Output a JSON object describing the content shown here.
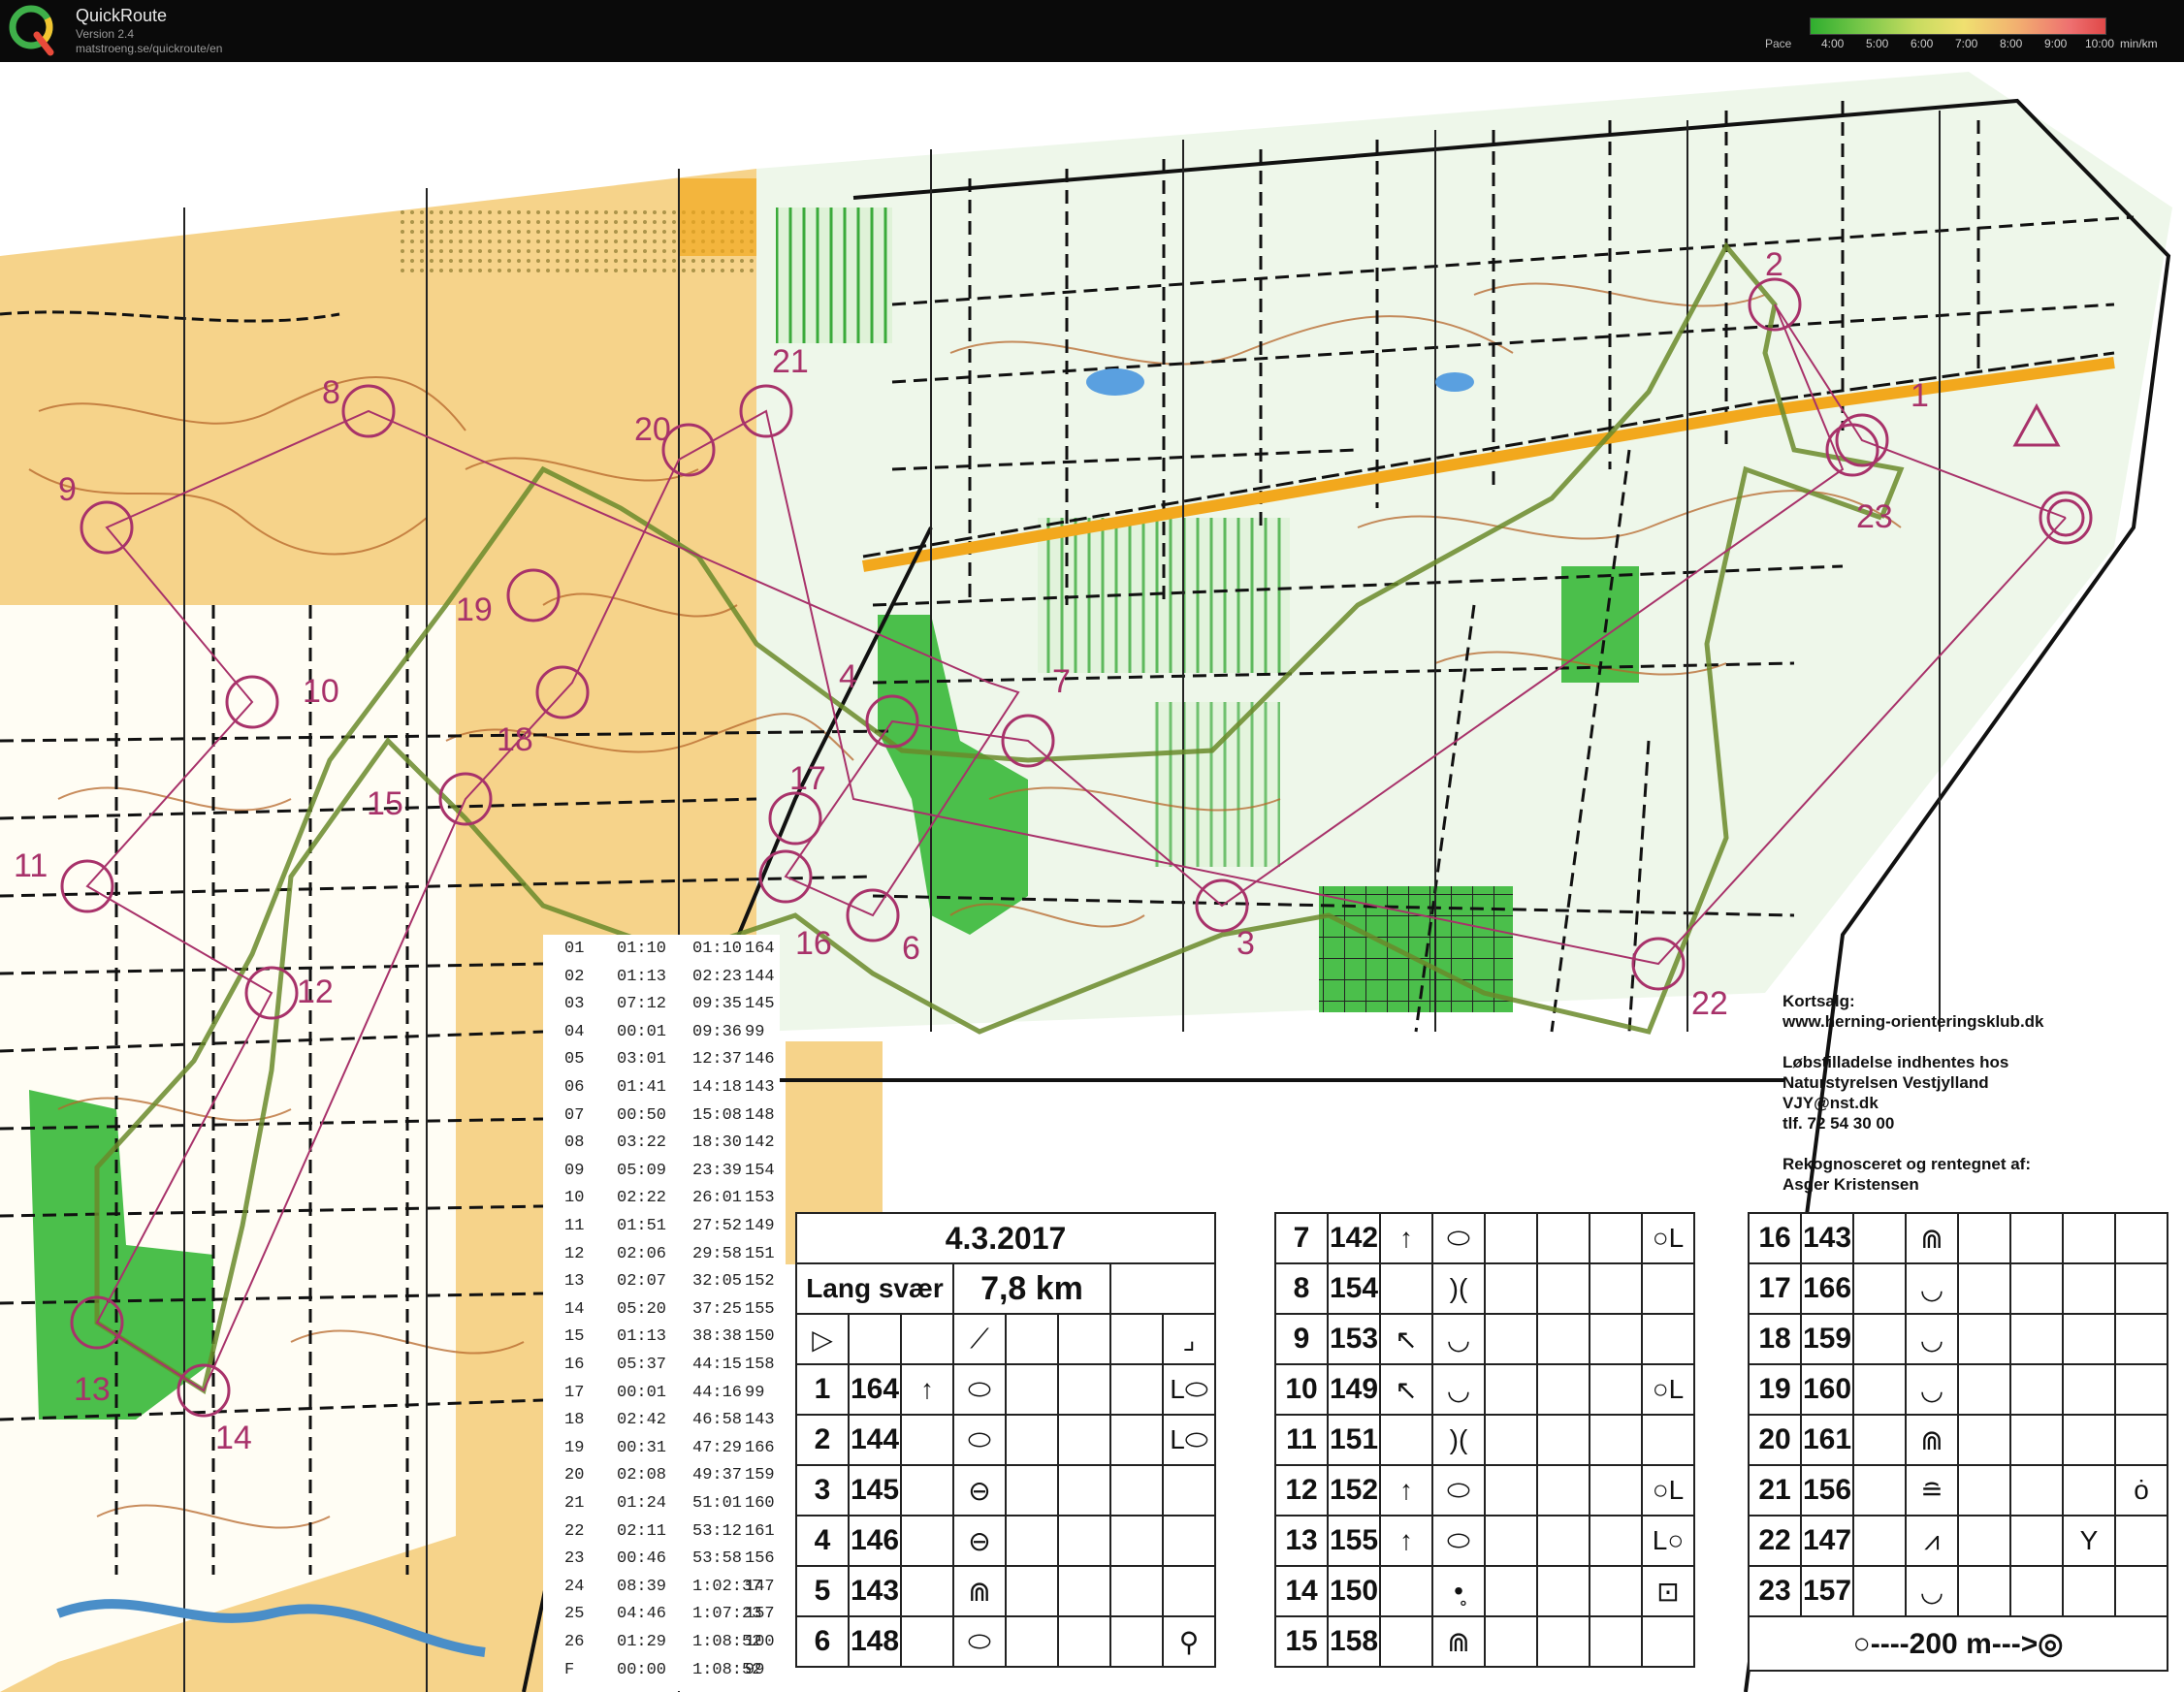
{
  "app": {
    "title": "QuickRoute",
    "version": "Version 2.4",
    "url": "matstroeng.se/quickroute/en",
    "pace_label": "Pace",
    "pace_ticks": [
      "4:00",
      "5:00",
      "6:00",
      "7:00",
      "8:00",
      "9:00",
      "10:00"
    ],
    "pace_unit": "min/km",
    "colors": {
      "route_purple": "#a8326a",
      "map_yellow": "#f6d38a",
      "map_green": "#4bbf4b",
      "contour_brown": "#b5652a",
      "road_orange": "#f2a81d"
    }
  },
  "map": {
    "controls": [
      "1",
      "2",
      "3",
      "4",
      "6",
      "7",
      "8",
      "9",
      "10",
      "11",
      "12",
      "13",
      "14",
      "15",
      "16",
      "17",
      "18",
      "19",
      "20",
      "21",
      "22",
      "23"
    ]
  },
  "splits": [
    [
      "01",
      "01:10",
      "01:10",
      "164"
    ],
    [
      "02",
      "01:13",
      "02:23",
      "144"
    ],
    [
      "03",
      "07:12",
      "09:35",
      "145"
    ],
    [
      "04",
      "00:01",
      "09:36",
      "99"
    ],
    [
      "05",
      "03:01",
      "12:37",
      "146"
    ],
    [
      "06",
      "01:41",
      "14:18",
      "143"
    ],
    [
      "07",
      "00:50",
      "15:08",
      "148"
    ],
    [
      "08",
      "03:22",
      "18:30",
      "142"
    ],
    [
      "09",
      "05:09",
      "23:39",
      "154"
    ],
    [
      "10",
      "02:22",
      "26:01",
      "153"
    ],
    [
      "11",
      "01:51",
      "27:52",
      "149"
    ],
    [
      "12",
      "02:06",
      "29:58",
      "151"
    ],
    [
      "13",
      "02:07",
      "32:05",
      "152"
    ],
    [
      "14",
      "05:20",
      "37:25",
      "155"
    ],
    [
      "15",
      "01:13",
      "38:38",
      "150"
    ],
    [
      "16",
      "05:37",
      "44:15",
      "158"
    ],
    [
      "17",
      "00:01",
      "44:16",
      "99"
    ],
    [
      "18",
      "02:42",
      "46:58",
      "143"
    ],
    [
      "19",
      "00:31",
      "47:29",
      "166"
    ],
    [
      "20",
      "02:08",
      "49:37",
      "159"
    ],
    [
      "21",
      "01:24",
      "51:01",
      "160"
    ],
    [
      "22",
      "02:11",
      "53:12",
      "161"
    ],
    [
      "23",
      "00:46",
      "53:58",
      "156"
    ],
    [
      "24",
      "08:39",
      "1:02:37",
      "147"
    ],
    [
      "25",
      "04:46",
      "1:07:23",
      "157"
    ],
    [
      "26",
      "01:29",
      "1:08:52",
      "100"
    ],
    [
      "F",
      "00:00",
      "1:08:52",
      "99"
    ]
  ],
  "info": {
    "line1": "Kortsalg:",
    "line2": "www.herning-orienteringsklub.dk",
    "line3": "Løbstilladelse indhentes hos",
    "line4": "Naturstyrelsen Vestjylland",
    "line5": "VJY@nst.dk",
    "line6": "tlf. 72 54 30 00",
    "line7": "Rekognosceret og rentegnet af:",
    "line8": "Asger Kristensen"
  },
  "description": {
    "date": "4.3.2017",
    "class": "Lang svær",
    "length": "7,8 km",
    "rows1": [
      {
        "n": "1",
        "code": "164",
        "dir": "↑",
        "feat": "⬭",
        "extra": "",
        "pos": "L⬭"
      },
      {
        "n": "2",
        "code": "144",
        "dir": "",
        "feat": "⬭",
        "extra": "",
        "pos": "L⬭"
      },
      {
        "n": "3",
        "code": "145",
        "dir": "",
        "feat": "⊖",
        "extra": "",
        "pos": ""
      },
      {
        "n": "4",
        "code": "146",
        "dir": "",
        "feat": "⊖",
        "extra": "",
        "pos": ""
      },
      {
        "n": "5",
        "code": "143",
        "dir": "",
        "feat": "⋒",
        "extra": "",
        "pos": ""
      },
      {
        "n": "6",
        "code": "148",
        "dir": "",
        "feat": "⬭",
        "extra": "",
        "pos": "⚲"
      }
    ],
    "rows2": [
      {
        "n": "7",
        "code": "142",
        "dir": "↑",
        "feat": "⬭",
        "extra": "",
        "pos": "○L"
      },
      {
        "n": "8",
        "code": "154",
        "dir": "",
        "feat": ")(",
        "extra": "",
        "pos": ""
      },
      {
        "n": "9",
        "code": "153",
        "dir": "↖",
        "feat": "◡",
        "extra": "",
        "pos": ""
      },
      {
        "n": "10",
        "code": "149",
        "dir": "↖",
        "feat": "◡",
        "extra": "",
        "pos": "○L"
      },
      {
        "n": "11",
        "code": "151",
        "dir": "",
        "feat": ")(",
        "extra": "",
        "pos": ""
      },
      {
        "n": "12",
        "code": "152",
        "dir": "↑",
        "feat": "⬭",
        "extra": "",
        "pos": "○L"
      },
      {
        "n": "13",
        "code": "155",
        "dir": "↑",
        "feat": "⬭",
        "extra": "",
        "pos": "L○"
      },
      {
        "n": "14",
        "code": "150",
        "dir": "",
        "feat": "•̥",
        "extra": "",
        "pos": "⊡"
      },
      {
        "n": "15",
        "code": "158",
        "dir": "",
        "feat": "⋒",
        "extra": "",
        "pos": ""
      }
    ],
    "rows3": [
      {
        "n": "16",
        "code": "143",
        "dir": "",
        "feat": "⋒",
        "extra": "",
        "pos": ""
      },
      {
        "n": "17",
        "code": "166",
        "dir": "",
        "feat": "◡",
        "extra": "",
        "pos": ""
      },
      {
        "n": "18",
        "code": "159",
        "dir": "",
        "feat": "◡",
        "extra": "",
        "pos": ""
      },
      {
        "n": "19",
        "code": "160",
        "dir": "",
        "feat": "◡",
        "extra": "",
        "pos": ""
      },
      {
        "n": "20",
        "code": "161",
        "dir": "",
        "feat": "⋒",
        "extra": "",
        "pos": ""
      },
      {
        "n": "21",
        "code": "156",
        "dir": "",
        "feat": "≘",
        "extra": "",
        "pos": "ȯ"
      },
      {
        "n": "22",
        "code": "147",
        "dir": "",
        "feat": "⩘",
        "extra": "Y",
        "pos": ""
      },
      {
        "n": "23",
        "code": "157",
        "dir": "",
        "feat": "◡",
        "extra": "",
        "pos": ""
      }
    ],
    "finish": "○----200 m--->◎"
  }
}
